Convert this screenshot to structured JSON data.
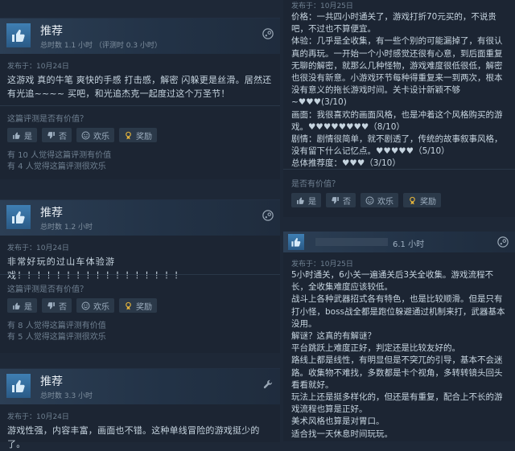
{
  "left_reviews": [
    {
      "title": "推荐",
      "hours": "总时数 1.1 小时 （评测时 0.3 小时）",
      "posted": "发布于：10月24日",
      "body": "这游戏 真的牛笔 爽快的手感 打击感，解密 闪躲更是丝滑。居然还有光追~~~~ 买吧，和光追杰克一起度过这个万圣节！",
      "question": "这篇评测是否有价值？",
      "yes": "是",
      "no": "否",
      "funny": "欢乐",
      "award": "奖励",
      "helpful_1": "有 10 人觉得这篇评测有价值",
      "helpful_2": "有 4 人觉得这篇评测很欢乐"
    },
    {
      "title": "推荐",
      "hours": "总时数 1.2 小时",
      "posted": "发布于：10月24日",
      "body": "非常好玩的过山车体验游戏！！！！！！！！！！！！！！！！！",
      "question": "这篇评测是否有价值？",
      "yes": "是",
      "no": "否",
      "funny": "欢乐",
      "award": "奖励",
      "helpful_1": "有 8 人觉得这篇评测有价值",
      "helpful_2": "有 5 人觉得这篇评测很欢乐"
    },
    {
      "title": "推荐",
      "hours": "总时数 3.3 小时",
      "posted": "发布于：10月24日",
      "body": "游戏性强，内容丰富，画面也不错。这种单线冒险的游戏挺少的了。"
    }
  ],
  "right_top": {
    "posted": "发布于：10月25日",
    "lines": [
      "价格：一共四小时通关了，游戏打折70元买的，不说贵吧，不过也不算便宜。",
      "体验：几乎是全收集，有一些个别的可能漏掉了，有很认真的再玩。一开始一个小时感觉还很有心意，到后面重复无聊的解密，就那么几种怪物，游戏难度很低很低，解密也很没有新意。小游戏环节每种得重复来一到两次，根本没有意义的拖长游戏时间。关卡设计新颖不够~♥♥♥(3/10)",
      "画面：我很喜欢的画面风格，也是冲着这个风格购买的游戏。♥♥♥♥♥♥♥♥（8/10）",
      "剧情：剧情很简单，就不剧透了，传统的故事叙事风格，没有留下什么记忆点。♥♥♥♥♥（5/10）",
      "总体推荐度：♥♥♥（3/10）"
    ],
    "question": "是否有价值？",
    "yes": "是",
    "no": "否",
    "funny": "欢乐",
    "award": "奖励"
  },
  "right_bottom": {
    "hours": "6.1 小时",
    "posted": "发布于：10月25日",
    "lines": [
      "5小时通关，6小关一遍通关后3关全收集。游戏流程不长，全收集难度应该较低。",
      "战斗上各种武器招式各有特色，也是比较顺滑。但是只有打小怪，boss战全都是跑位躲避通过机制来打，武器基本没用。",
      "解谜？这真的有解谜？",
      "平台跳跃上难度正好，判定还是比较友好的。",
      "路线上都是线性，有明显但是不突兀的引导，基本不会迷路。收集物不难找，多数都是卡个视角，多转转镜头回头看看就好。",
      "玩法上还是挺多样化的，但还是有重复，配合上不长的游戏流程也算是正好。",
      "美术风格也算是对胃口。",
      "适合找一天休息时间玩玩。"
    ]
  },
  "colors": {
    "bg": "#1e2837",
    "card": "#1c2533",
    "header": "#2c3f55",
    "accent_thumb": "#3f7fb3"
  }
}
